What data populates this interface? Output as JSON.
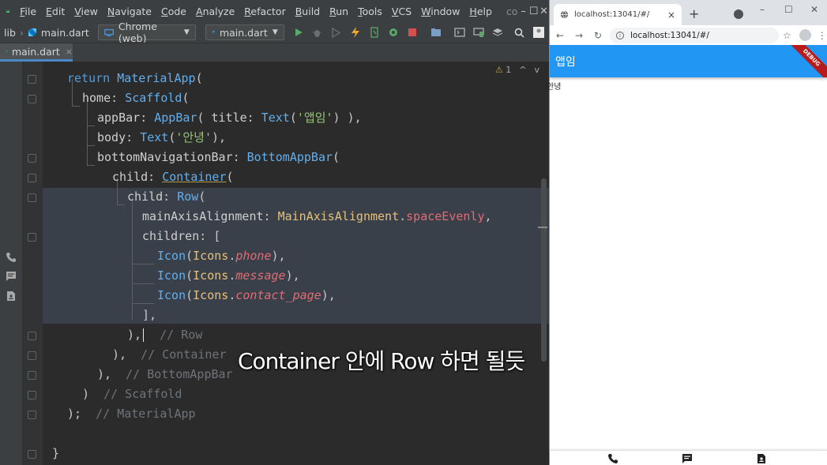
{
  "ide": {
    "menu": [
      "File",
      "Edit",
      "View",
      "Navigate",
      "Code",
      "Analyze",
      "Refactor",
      "Build",
      "Run",
      "Tools",
      "VCS",
      "Window",
      "Help"
    ],
    "project_name": "contact",
    "window_controls": [
      "–",
      "☐",
      "✕"
    ],
    "toolbar": {
      "crumb_root": "lib",
      "crumb_file": "main.dart",
      "device_selector": "Chrome (web)",
      "run_config": "main.dart"
    },
    "tab": {
      "label": "main.dart",
      "close": "×"
    },
    "inspections": {
      "warning_count": "1",
      "up": "^",
      "down": "v",
      "warning_icon": "⚠"
    },
    "code": {
      "l1": [
        "return",
        "MaterialApp",
        "("
      ],
      "l2": [
        "home",
        ":",
        "Scaffold",
        "("
      ],
      "l3": [
        "appBar",
        ":",
        "AppBar",
        "(",
        "title",
        ":",
        "Text",
        "(",
        "'앱임'",
        ")",
        ")",
        ","
      ],
      "l4": [
        "body",
        ":",
        "Text",
        "(",
        "'안녕'",
        ")",
        ","
      ],
      "l5": [
        "bottomNavigationBar",
        ":",
        "BottomAppBar",
        "("
      ],
      "l6": [
        "child",
        ":",
        "Container",
        "("
      ],
      "l7": [
        "child",
        ":",
        "Row",
        "("
      ],
      "l8": [
        "mainAxisAlignment",
        ":",
        "MainAxisAlignment",
        ".",
        "spaceEvenly",
        ","
      ],
      "l9": [
        "children",
        ":",
        "["
      ],
      "l10": [
        "Icon",
        "(",
        "Icons",
        ".",
        "phone",
        ")",
        ","
      ],
      "l11": [
        "Icon",
        "(",
        "Icons",
        ".",
        "message",
        ")",
        ","
      ],
      "l12": [
        "Icon",
        "(",
        "Icons",
        ".",
        "contact_page",
        ")",
        ","
      ],
      "l13": [
        "],"
      ],
      "l14": [
        "),",
        "// Row"
      ],
      "l15": [
        "),",
        "// Container"
      ],
      "l16": [
        "),",
        "// BottomAppBar"
      ],
      "l17": [
        ")",
        "// Scaffold"
      ],
      "l18": [
        ");",
        "// MaterialApp"
      ],
      "l19": [
        "}"
      ]
    },
    "subtitle": "Container 안에 Row 하면 될듯"
  },
  "browser": {
    "tab_title": "localhost:13041/#/",
    "tab_close": "×",
    "new_tab": "+",
    "window_controls": [
      "–",
      "☐",
      "✕"
    ],
    "nav": {
      "back": "←",
      "forward": "→",
      "reload": "↻",
      "info": "i"
    },
    "url": "localhost:13041/#/",
    "star": "☆",
    "more": "⋮",
    "app": {
      "title": "앱임",
      "debug_banner": "DEBUG",
      "body_text": "안녕",
      "bottom_icons": [
        "phone-icon",
        "message-icon",
        "contact-page-icon"
      ]
    }
  },
  "colors": {
    "app_bar": "#2196f3",
    "debug_banner": "#b71c1c",
    "editor_bg": "#2b2b2b",
    "selection": "#3a4049"
  }
}
